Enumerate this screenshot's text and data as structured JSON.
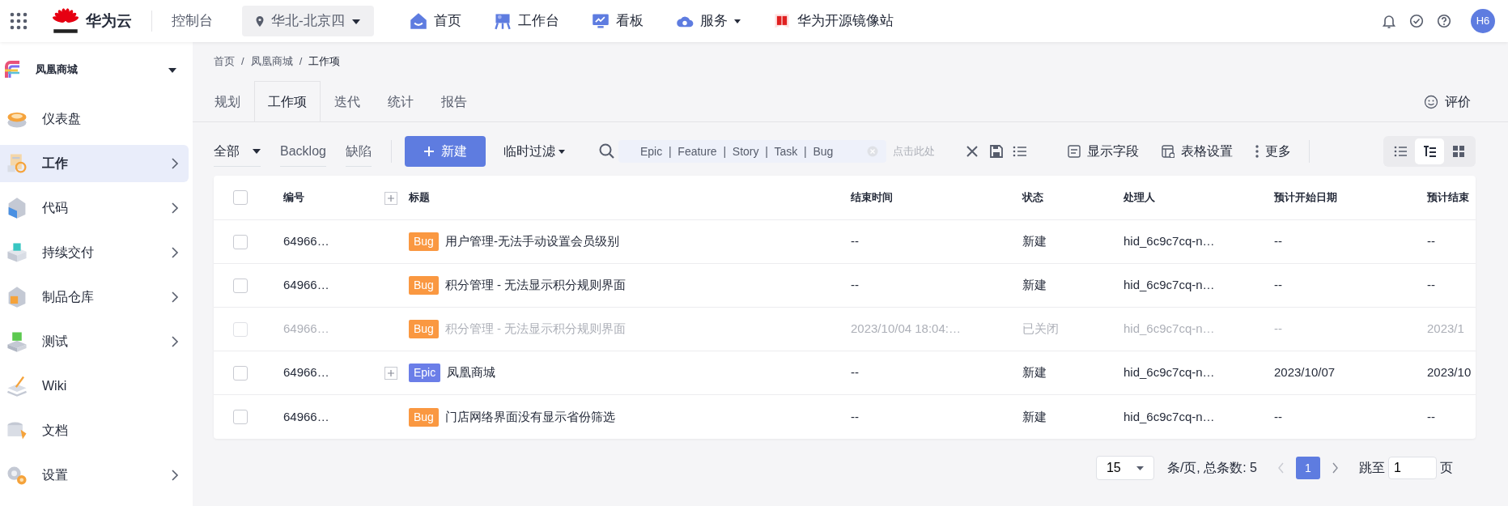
{
  "topbar": {
    "brand": "华为云",
    "console": "控制台",
    "region": "华北-北京四",
    "nav": [
      {
        "label": "首页",
        "has_menu": false
      },
      {
        "label": "工作台",
        "has_menu": false
      },
      {
        "label": "看板",
        "has_menu": false
      },
      {
        "label": "服务",
        "has_menu": true
      },
      {
        "label": "华为开源镜像站",
        "has_menu": false
      }
    ],
    "avatar": "H6"
  },
  "project": {
    "name": "凤凰商城"
  },
  "sidebar": {
    "items": [
      {
        "label": "仪表盘",
        "selected": false,
        "expandable": false
      },
      {
        "label": "工作",
        "selected": true,
        "expandable": true
      },
      {
        "label": "代码",
        "selected": false,
        "expandable": true
      },
      {
        "label": "持续交付",
        "selected": false,
        "expandable": true
      },
      {
        "label": "制品仓库",
        "selected": false,
        "expandable": true
      },
      {
        "label": "测试",
        "selected": false,
        "expandable": true
      },
      {
        "label": "Wiki",
        "selected": false,
        "expandable": false
      },
      {
        "label": "文档",
        "selected": false,
        "expandable": false
      },
      {
        "label": "设置",
        "selected": false,
        "expandable": true
      }
    ]
  },
  "breadcrumb": [
    {
      "label": "首页",
      "kind": "link"
    },
    {
      "label": "/",
      "kind": "separator"
    },
    {
      "label": "凤凰商城",
      "kind": "link"
    },
    {
      "label": "/",
      "kind": "separator"
    },
    {
      "label": "工作项",
      "kind": "current"
    }
  ],
  "tabs": [
    {
      "label": "规划",
      "selected": false
    },
    {
      "label": "工作项",
      "selected": true
    },
    {
      "label": "迭代",
      "selected": false
    },
    {
      "label": "统计",
      "selected": false
    },
    {
      "label": "报告",
      "selected": false
    }
  ],
  "feedback": "评价",
  "filters": [
    {
      "label": "全部",
      "selected": true,
      "has_menu": true
    },
    {
      "label": "Backlog",
      "selected": false,
      "has_menu": false
    },
    {
      "label": "缺陷",
      "selected": false,
      "has_menu": false
    }
  ],
  "new_button": "新建",
  "temp_filter": "临时过滤",
  "search": {
    "value": "Epic  |  Feature  |  Story  |  Task  |  Bug",
    "placeholder": "点击此处"
  },
  "actions": [
    "显示字段",
    "表格设置",
    "更多"
  ],
  "views": [
    {
      "selected": false
    },
    {
      "selected": true
    },
    {
      "selected": false
    }
  ],
  "table": {
    "all_checked": false,
    "columns": [
      "编号",
      "标题",
      "结束时间",
      "状态",
      "处理人",
      "预计开始日期",
      "预计结束"
    ],
    "rows": [
      {
        "id": "64966…",
        "type": "Bug",
        "kind": "bug",
        "checked": false,
        "expandable": false,
        "title": "用户管理-无法手动设置会员级别",
        "end_time": "--",
        "status": "新建",
        "assignee": "hid_6c9c7cq-n…",
        "start_date": "--",
        "end_date": "--",
        "closed": false
      },
      {
        "id": "64966…",
        "type": "Bug",
        "kind": "bug",
        "checked": false,
        "expandable": false,
        "title": "积分管理 - 无法显示积分规则界面",
        "end_time": "--",
        "status": "新建",
        "assignee": "hid_6c9c7cq-n…",
        "start_date": "--",
        "end_date": "--",
        "closed": false
      },
      {
        "id": "64966…",
        "type": "Bug",
        "kind": "bug",
        "checked": false,
        "expandable": false,
        "title": "积分管理 - 无法显示积分规则界面",
        "end_time": "2023/10/04 18:04:…",
        "status": "已关闭",
        "assignee": "hid_6c9c7cq-n…",
        "start_date": "--",
        "end_date": "2023/1",
        "closed": true
      },
      {
        "id": "64966…",
        "type": "Epic",
        "kind": "epic",
        "checked": false,
        "expandable": true,
        "title": "凤凰商城",
        "end_time": "--",
        "status": "新建",
        "assignee": "hid_6c9c7cq-n…",
        "start_date": "2023/10/07",
        "end_date": "2023/10",
        "closed": false
      },
      {
        "id": "64966…",
        "type": "Bug",
        "kind": "bug",
        "checked": false,
        "expandable": false,
        "title": "门店网络界面没有显示省份筛选",
        "end_time": "--",
        "status": "新建",
        "assignee": "hid_6c9c7cq-n…",
        "start_date": "--",
        "end_date": "--",
        "closed": false
      }
    ]
  },
  "pagination": {
    "page_size": "15",
    "summary": "条/页, 总条数: 5",
    "pages": [
      {
        "label": "1",
        "selected": true
      }
    ],
    "jump_label": "跳至",
    "jump_value": "1",
    "unit": "页"
  }
}
